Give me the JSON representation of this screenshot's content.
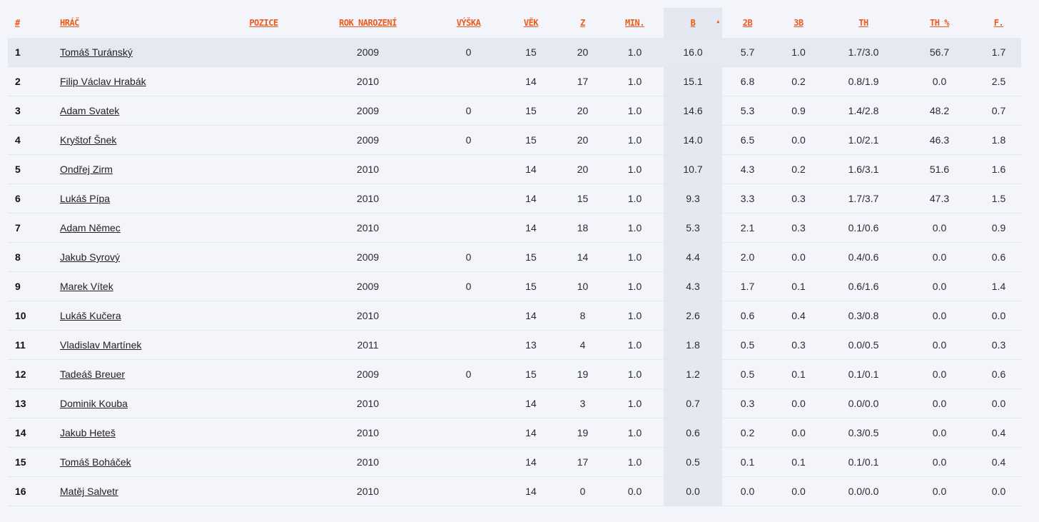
{
  "columns": [
    {
      "label": "#"
    },
    {
      "label": "HRÁČ"
    },
    {
      "label": "POZICE"
    },
    {
      "label": "ROK NAROZENÍ"
    },
    {
      "label": "VÝŠKA"
    },
    {
      "label": "VĚK"
    },
    {
      "label": "Z"
    },
    {
      "label": "MIN."
    },
    {
      "label": "B",
      "sort_indicator": "▲"
    },
    {
      "label": "2B"
    },
    {
      "label": "3B"
    },
    {
      "label": "TH"
    },
    {
      "label": "TH %"
    },
    {
      "label": "F."
    }
  ],
  "rows": [
    {
      "rank": "1",
      "name": "Tomáš Turánský",
      "position": "",
      "born": "2009",
      "height": "0",
      "age": "15",
      "games": "20",
      "min": "1.0",
      "pts": "16.0",
      "p2": "5.7",
      "p3": "1.0",
      "ft": "1.7/3.0",
      "ftpct": "56.7",
      "fouls": "1.7"
    },
    {
      "rank": "2",
      "name": "Filip Václav Hrabák",
      "position": "",
      "born": "2010",
      "height": "",
      "age": "14",
      "games": "17",
      "min": "1.0",
      "pts": "15.1",
      "p2": "6.8",
      "p3": "0.2",
      "ft": "0.8/1.9",
      "ftpct": "0.0",
      "fouls": "2.5"
    },
    {
      "rank": "3",
      "name": "Adam Svatek",
      "position": "",
      "born": "2009",
      "height": "0",
      "age": "15",
      "games": "20",
      "min": "1.0",
      "pts": "14.6",
      "p2": "5.3",
      "p3": "0.9",
      "ft": "1.4/2.8",
      "ftpct": "48.2",
      "fouls": "0.7"
    },
    {
      "rank": "4",
      "name": "Kryštof Šnek",
      "position": "",
      "born": "2009",
      "height": "0",
      "age": "15",
      "games": "20",
      "min": "1.0",
      "pts": "14.0",
      "p2": "6.5",
      "p3": "0.0",
      "ft": "1.0/2.1",
      "ftpct": "46.3",
      "fouls": "1.8"
    },
    {
      "rank": "5",
      "name": "Ondřej Zirm",
      "position": "",
      "born": "2010",
      "height": "",
      "age": "14",
      "games": "20",
      "min": "1.0",
      "pts": "10.7",
      "p2": "4.3",
      "p3": "0.2",
      "ft": "1.6/3.1",
      "ftpct": "51.6",
      "fouls": "1.6"
    },
    {
      "rank": "6",
      "name": "Lukáš Pípa",
      "position": "",
      "born": "2010",
      "height": "",
      "age": "14",
      "games": "15",
      "min": "1.0",
      "pts": "9.3",
      "p2": "3.3",
      "p3": "0.3",
      "ft": "1.7/3.7",
      "ftpct": "47.3",
      "fouls": "1.5"
    },
    {
      "rank": "7",
      "name": "Adam Němec",
      "position": "",
      "born": "2010",
      "height": "",
      "age": "14",
      "games": "18",
      "min": "1.0",
      "pts": "5.3",
      "p2": "2.1",
      "p3": "0.3",
      "ft": "0.1/0.6",
      "ftpct": "0.0",
      "fouls": "0.9"
    },
    {
      "rank": "8",
      "name": "Jakub Syrový",
      "position": "",
      "born": "2009",
      "height": "0",
      "age": "15",
      "games": "14",
      "min": "1.0",
      "pts": "4.4",
      "p2": "2.0",
      "p3": "0.0",
      "ft": "0.4/0.6",
      "ftpct": "0.0",
      "fouls": "0.6"
    },
    {
      "rank": "9",
      "name": "Marek Vítek",
      "position": "",
      "born": "2009",
      "height": "0",
      "age": "15",
      "games": "10",
      "min": "1.0",
      "pts": "4.3",
      "p2": "1.7",
      "p3": "0.1",
      "ft": "0.6/1.6",
      "ftpct": "0.0",
      "fouls": "1.4"
    },
    {
      "rank": "10",
      "name": "Lukáš Kučera",
      "position": "",
      "born": "2010",
      "height": "",
      "age": "14",
      "games": "8",
      "min": "1.0",
      "pts": "2.6",
      "p2": "0.6",
      "p3": "0.4",
      "ft": "0.3/0.8",
      "ftpct": "0.0",
      "fouls": "0.0"
    },
    {
      "rank": "11",
      "name": "Vladislav Martínek",
      "position": "",
      "born": "2011",
      "height": "",
      "age": "13",
      "games": "4",
      "min": "1.0",
      "pts": "1.8",
      "p2": "0.5",
      "p3": "0.3",
      "ft": "0.0/0.5",
      "ftpct": "0.0",
      "fouls": "0.3"
    },
    {
      "rank": "12",
      "name": "Tadeáš Breuer",
      "position": "",
      "born": "2009",
      "height": "0",
      "age": "15",
      "games": "19",
      "min": "1.0",
      "pts": "1.2",
      "p2": "0.5",
      "p3": "0.1",
      "ft": "0.1/0.1",
      "ftpct": "0.0",
      "fouls": "0.6"
    },
    {
      "rank": "13",
      "name": "Dominik Kouba",
      "position": "",
      "born": "2010",
      "height": "",
      "age": "14",
      "games": "3",
      "min": "1.0",
      "pts": "0.7",
      "p2": "0.3",
      "p3": "0.0",
      "ft": "0.0/0.0",
      "ftpct": "0.0",
      "fouls": "0.0"
    },
    {
      "rank": "14",
      "name": "Jakub Heteš",
      "position": "",
      "born": "2010",
      "height": "",
      "age": "14",
      "games": "19",
      "min": "1.0",
      "pts": "0.6",
      "p2": "0.2",
      "p3": "0.0",
      "ft": "0.3/0.5",
      "ftpct": "0.0",
      "fouls": "0.4"
    },
    {
      "rank": "15",
      "name": "Tomáš Boháček",
      "position": "",
      "born": "2010",
      "height": "",
      "age": "14",
      "games": "17",
      "min": "1.0",
      "pts": "0.5",
      "p2": "0.1",
      "p3": "0.1",
      "ft": "0.1/0.1",
      "ftpct": "0.0",
      "fouls": "0.4"
    },
    {
      "rank": "16",
      "name": "Matěj Salvetr",
      "position": "",
      "born": "2010",
      "height": "",
      "age": "14",
      "games": "0",
      "min": "0.0",
      "pts": "0.0",
      "p2": "0.0",
      "p3": "0.0",
      "ft": "0.0/0.0",
      "ftpct": "0.0",
      "fouls": "0.0"
    }
  ],
  "colors": {
    "header_text": "#ee5a1e",
    "sorted_column_bg": "#e5e8f1",
    "page_bg": "#f3f5fa"
  },
  "icons": {
    "sort_icon": "triangle-up"
  }
}
